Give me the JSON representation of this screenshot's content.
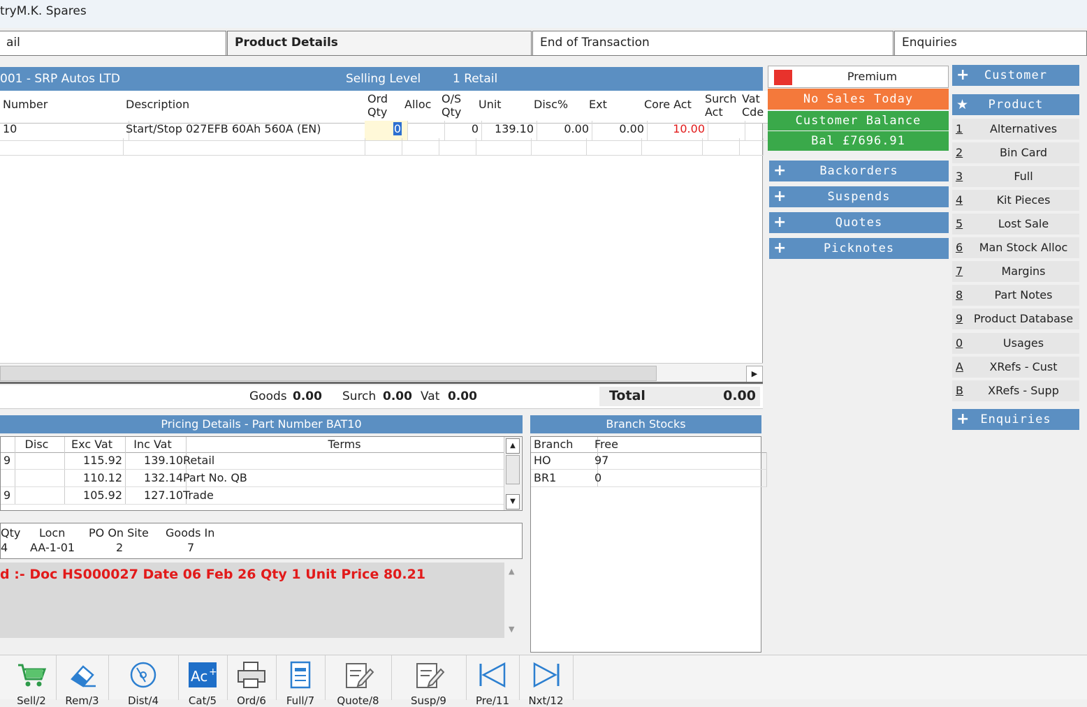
{
  "window": {
    "title": "tryM.K. Spares"
  },
  "tabs": [
    {
      "label": "ail"
    },
    {
      "label": "Product Details"
    },
    {
      "label": "End of Transaction"
    },
    {
      "label": "Enquiries"
    }
  ],
  "order_header": {
    "customer": "001 - SRP Autos LTD",
    "selling_level_label": "Selling Level",
    "selling_level_value": "1 Retail"
  },
  "grid": {
    "columns": [
      "Number",
      "Description",
      "Ord Qty",
      "Alloc",
      "O/S Qty",
      "Unit",
      "Disc%",
      "Ext",
      "Core Act",
      "Surch Act",
      "Vat Cde"
    ],
    "row": {
      "number": "10",
      "description": "Start/Stop 027EFB 60Ah 560A (EN)",
      "ord_qty": "0",
      "alloc": "",
      "os_qty": "0",
      "unit": "139.10",
      "disc": "0.00",
      "ext": "0.00",
      "core_act": "10.00"
    }
  },
  "totals": {
    "goods_label": "Goods",
    "goods": "0.00",
    "surch_label": "Surch",
    "surch": "0.00",
    "vat_label": "Vat",
    "vat": "0.00",
    "total_label": "Total",
    "total": "0.00"
  },
  "status": {
    "premium": "Premium",
    "no_sales": "No Sales Today",
    "balance_label": "Customer Balance",
    "balance": "Bal £7696.91",
    "colors": {
      "premium_swatch": "#e8322c",
      "no_sales_bg": "#f4793b",
      "balance_bg": "#3aa94a",
      "band_blue": "#5b8fc2"
    }
  },
  "side_buttons": [
    "Backorders",
    "Suspends",
    "Quotes",
    "Picknotes"
  ],
  "right_nav": {
    "customer": "Customer",
    "product": "Product",
    "enquiries": "Enquiries",
    "items": [
      {
        "key": "1",
        "label": "Alternatives"
      },
      {
        "key": "2",
        "label": "Bin Card"
      },
      {
        "key": "3",
        "label": "Full"
      },
      {
        "key": "4",
        "label": "Kit Pieces"
      },
      {
        "key": "5",
        "label": "Lost Sale"
      },
      {
        "key": "6",
        "label": "Man Stock Alloc"
      },
      {
        "key": "7",
        "label": "Margins"
      },
      {
        "key": "8",
        "label": "Part Notes"
      },
      {
        "key": "9",
        "label": "Product Database"
      },
      {
        "key": "0",
        "label": "Usages"
      },
      {
        "key": "A",
        "label": "XRefs - Cust"
      },
      {
        "key": "B",
        "label": "XRefs - Supp"
      }
    ]
  },
  "pricing": {
    "title": "Pricing Details - Part Number BAT10",
    "columns": [
      "Disc",
      "Exc Vat",
      "Inc Vat",
      "Terms"
    ],
    "rows": [
      {
        "lead": "9",
        "disc": "",
        "exc": "115.92",
        "inc": "139.10",
        "terms": "Retail"
      },
      {
        "lead": "",
        "disc": "",
        "exc": "110.12",
        "inc": "132.14",
        "terms": "Part No. QB"
      },
      {
        "lead": "9",
        "disc": "",
        "exc": "105.92",
        "inc": "127.10",
        "terms": "Trade"
      }
    ]
  },
  "branch_stocks": {
    "title": "Branch Stocks",
    "columns": [
      "Branch",
      "Free"
    ],
    "rows": [
      {
        "branch": "HO",
        "free": "97"
      },
      {
        "branch": "BR1",
        "free": "0"
      }
    ]
  },
  "stock_info": {
    "qty_label": "Qty",
    "qty": "4",
    "locn_label": "Locn",
    "locn": "AA-1-01",
    "po_label": "PO On Site",
    "po": "2",
    "goods_in_label": "Goods In",
    "goods_in": "7"
  },
  "note": {
    "text": "d :- Doc HS000027 Date 06 Feb 26 Qty 1 Unit Price 80.21"
  },
  "toolbar": [
    {
      "icon": "cart-icon",
      "label": "Sell/2"
    },
    {
      "icon": "eraser-icon",
      "label": "Rem/3"
    },
    {
      "icon": "disc-icon",
      "label": "Dist/4"
    },
    {
      "icon": "ac-icon",
      "label": "Cat/5"
    },
    {
      "icon": "print-icon",
      "label": "Ord/6"
    },
    {
      "icon": "document-icon",
      "label": "Full/7"
    },
    {
      "icon": "edit-icon",
      "label": "Quote/8"
    },
    {
      "icon": "edit2-icon",
      "label": "Susp/9"
    },
    {
      "icon": "first-icon",
      "label": "Pre/11"
    },
    {
      "icon": "last-icon",
      "label": "Nxt/12"
    }
  ]
}
